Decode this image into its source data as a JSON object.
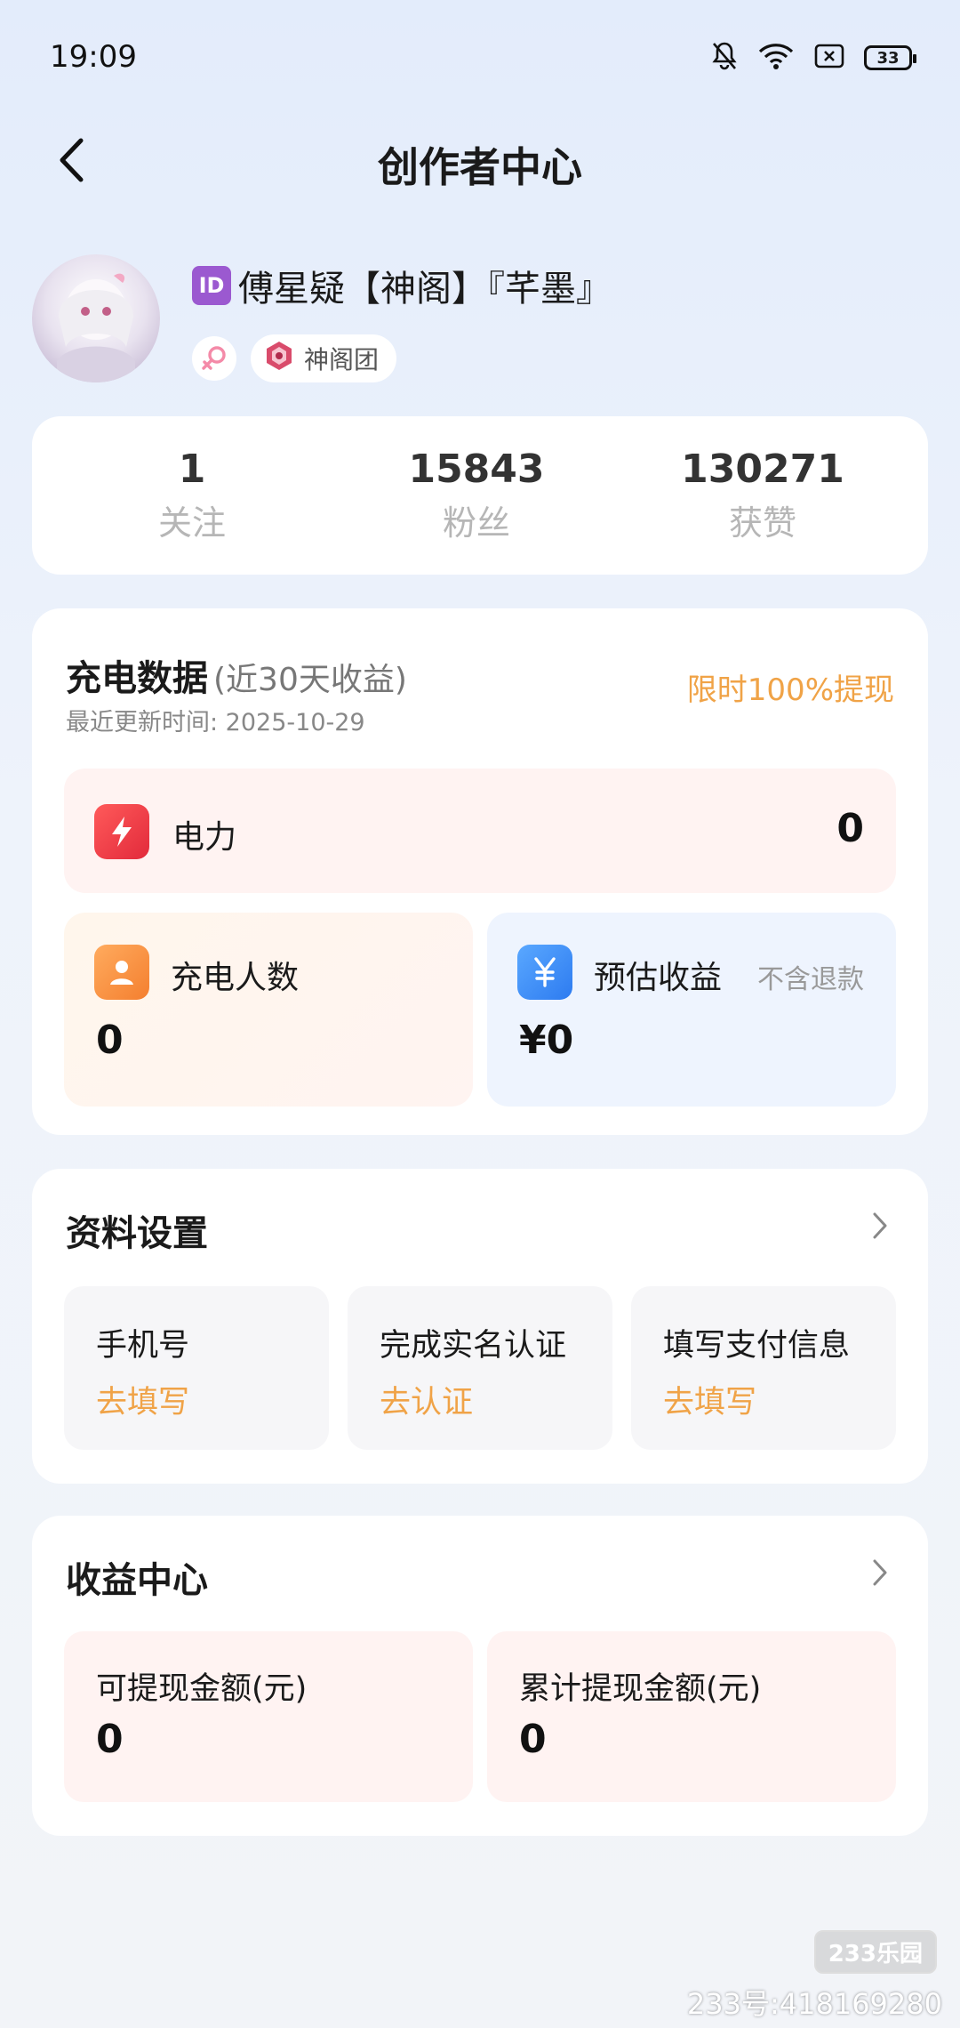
{
  "status_bar": {
    "time": "19:09",
    "battery": "33"
  },
  "nav": {
    "title": "创作者中心"
  },
  "profile": {
    "id_tag": "ID",
    "name": "傅星疑【神阁】『芊墨』",
    "group_badge": "神阁团"
  },
  "stats": [
    {
      "value": "1",
      "label": "关注"
    },
    {
      "value": "15843",
      "label": "粉丝"
    },
    {
      "value": "130271",
      "label": "获赞"
    }
  ],
  "charge": {
    "title": "充电数据",
    "subtitle": "(近30天收益)",
    "updated": "最近更新时间: 2025-10-29",
    "promo": "限时100%提现",
    "power": {
      "label": "电力",
      "value": "0"
    },
    "supporters": {
      "label": "充电人数",
      "value": "0"
    },
    "estimated": {
      "label": "预估收益",
      "hint": "不含退款",
      "value": "¥0"
    }
  },
  "settings": {
    "title": "资料设置",
    "items": [
      {
        "label": "手机号",
        "action": "去填写"
      },
      {
        "label": "完成实名认证",
        "action": "去认证"
      },
      {
        "label": "填写支付信息",
        "action": "去填写"
      }
    ]
  },
  "income": {
    "title": "收益中心",
    "items": [
      {
        "label": "可提现金额(元)",
        "value": "0"
      },
      {
        "label": "累计提现金额(元)",
        "value": "0"
      }
    ]
  },
  "watermark": {
    "logo": "233乐园",
    "text": "233号:418169280"
  },
  "colors": {
    "accent": "#f0a347",
    "power_icon": "#e8313e",
    "supporters_icon": "#f5953e",
    "estimated_icon": "#3d8ef8"
  }
}
